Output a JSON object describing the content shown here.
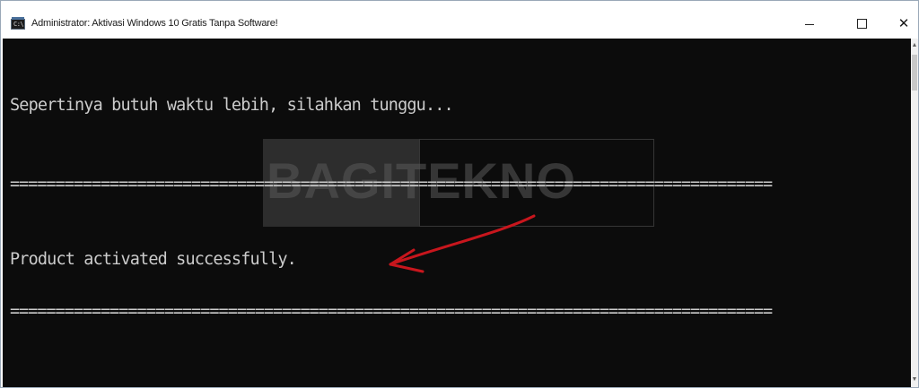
{
  "window": {
    "title": "Administrator:  Aktivasi Windows 10 Gratis Tanpa Software!",
    "icon": "console-icon",
    "icon_glyph": "C:\\",
    "controls": {
      "minimize": "minimize-icon",
      "maximize": "maximize-icon",
      "close": "close-icon",
      "close_glyph": "✕"
    }
  },
  "console": {
    "lines": [
      "Sepertinya butuh waktu lebih, silahkan tunggu...",
      "====================================================================================",
      "Product activated successfully.",
      "===================================================================================="
    ],
    "background": "#0c0c0c",
    "foreground": "#cccccc"
  },
  "watermark": {
    "text": "BAGITEKNO"
  },
  "annotation": {
    "arrow_color": "#c8161d"
  },
  "scrollbar": {
    "up_glyph": "▲",
    "down_glyph": "▼"
  }
}
